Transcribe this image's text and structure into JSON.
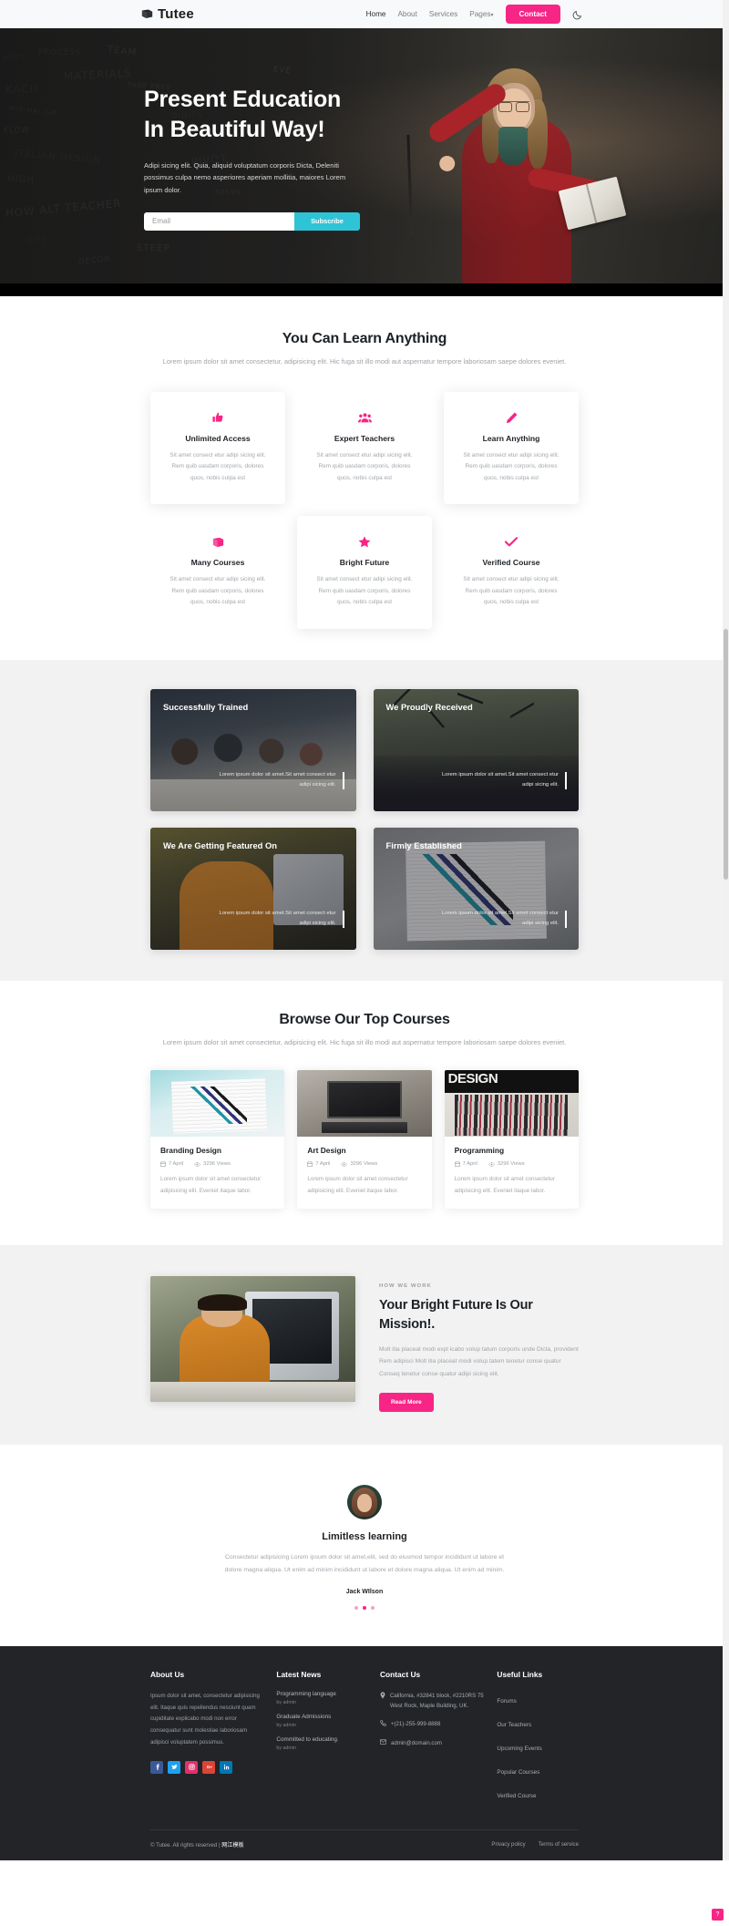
{
  "nav": {
    "brand": "Tutee",
    "brand_icon": "book-icon",
    "links": [
      {
        "label": "Home",
        "active": true
      },
      {
        "label": "About",
        "active": false
      },
      {
        "label": "Services",
        "active": false
      },
      {
        "label": "Pages",
        "active": false,
        "caret": "▾"
      }
    ],
    "contact_label": "Contact",
    "theme_toggle_icon": "moon-icon"
  },
  "hero": {
    "title_line1": "Present Education",
    "title_line2": "In Beautiful Way!",
    "paragraph": "Adipi sicing elit. Quia, aliquid voluptatum corporis Dicta, Deleniti possimus culpa nemo asperiores aperiam mollitia, maiores Lorem ipsum dolor.",
    "email_placeholder": "Email",
    "email_value": "",
    "subscribe_label": "Subscribe",
    "chalk_words": [
      "KITCH",
      "PROCESS",
      "TEAM",
      "KACH",
      "MINIMALISM",
      "FLOW",
      "ITALIAN DESIGN",
      "MATERIALS",
      "PAGE PRES",
      "DIGITS",
      "HIGH",
      "HOW ALT TEACHER",
      "AIMS",
      "DECOR",
      "STEEP",
      "PIVOT",
      "FOCUS",
      "EVE"
    ]
  },
  "learn": {
    "heading": "You Can Learn Anything",
    "subheading": "Lorem ipsum dolor sit amet consectetur, adipisicing elit. Hic fuga sit illo modi aut aspernatur tempore laboriosam saepe dolores eveniet.",
    "cards": [
      {
        "icon": "thumbs-up-icon",
        "title": "Unlimited Access",
        "text": "Sit amet consect etur adipi sicing elit. Rem quib uasdam corporis, dolores quos, nobis culpa est"
      },
      {
        "icon": "users-icon",
        "title": "Expert Teachers",
        "text": "Sit amet consect etur adipi sicing elit. Rem quib uasdam corporis, dolores quos, nobis culpa est"
      },
      {
        "icon": "pencil-icon",
        "title": "Learn Anything",
        "text": "Sit amet consect etur adipi sicing elit. Rem quib uasdam corporis, dolores quos, nobis culpa est"
      },
      {
        "icon": "book-icon",
        "title": "Many Courses",
        "text": "Sit amet consect etur adipi sicing elit. Rem quib uasdam corporis, dolores quos, nobis culpa est"
      },
      {
        "icon": "star-icon",
        "title": "Bright Future",
        "text": "Sit amet consect etur adipi sicing elit. Rem quib uasdam corporis, dolores quos, nobis culpa est"
      },
      {
        "icon": "check-icon",
        "title": "Verified Course",
        "text": "Sit amet consect etur adipi sicing elit. Rem quib uasdam corporis, dolores quos, nobis culpa est"
      }
    ]
  },
  "gallery": {
    "cards": [
      {
        "title": "Successfully Trained",
        "caption": "Lorem ipsum dolor sit amet.Sit amet consect etur adipi sicing elit."
      },
      {
        "title": "We Proudly Received",
        "caption": "Lorem ipsum dolor sit amet.Sit amet consect etur adipi sicing elit."
      },
      {
        "title": "We Are Getting Featured On",
        "caption": "Lorem ipsum dolor sit amet.Sit amet consect etur adipi sicing elit."
      },
      {
        "title": "Firmly Established",
        "caption": "Lorem ipsum dolor sit amet.Sit amet consect etur adipi sicing elit."
      }
    ]
  },
  "courses": {
    "heading": "Browse Our Top Courses",
    "subheading": "Lorem ipsum dolor sit amet consectetur, adipisicing elit. Hic fuga sit illo modi aut aspernatur tempore laboriosam saepe dolores eveniet.",
    "cards": [
      {
        "title": "Branding Design",
        "date": "7 April",
        "views": "3296 Views",
        "text": "Lorem ipsum dolor sit amet consectetur adipisicing elit. Eveniet itaque labor."
      },
      {
        "title": "Art Design",
        "date": "7 April",
        "views": "3296 Views",
        "text": "Lorem ipsum dolor sit amet consectetur adipisicing elit. Eveniet itaque labor."
      },
      {
        "title": "Programming",
        "date": "7 April",
        "views": "3296 Views",
        "text": "Lorem ipsum dolor sit amet consectetur adipisicing elit. Eveniet itaque labor.",
        "thumb_label": "DESIGN"
      }
    ]
  },
  "mission": {
    "kicker": "HOW WE WORK",
    "heading": "Your Bright Future Is Our Mission!.",
    "paragraph": "Molt itia placeat modi expl icabo volup tatum corporis unde Dicta, provident Rem adipisci Molt itia placeat modi volup.tatem tenetur conse quatur Conseq tenetur conse quatur adipi sicing elit.",
    "button": "Read More"
  },
  "testimonial": {
    "avatar": "user-avatar",
    "title": "Limitless learning",
    "quote": "Consectetur adipisicing Lorem ipsum dolor sit amet,elit, sed do eiusmod tempor incididunt ut labore et dolore magna aliqua. Ut enim ad minim incididunt ut labore et dolore magna aliqua. Ut enim ad minim.",
    "author": "Jack WIlson",
    "dots": 3,
    "active_dot": 1
  },
  "footer": {
    "about": {
      "heading": "About Us",
      "text": "Ipsum dolor sit amet, consectetur adipisicing elit. Itaque quis repellendus nesciunt quam cupiditate explicabo modi non error consequatur sunt molestiae laboriosam adipisci voluptatem possimus.",
      "socials": [
        {
          "name": "facebook-icon",
          "color": "#3b5998"
        },
        {
          "name": "twitter-icon",
          "color": "#1da1f2"
        },
        {
          "name": "instagram-icon",
          "color": "#e1306c"
        },
        {
          "name": "google-plus-icon",
          "color": "#db4437"
        },
        {
          "name": "linkedin-icon",
          "color": "#0077b5"
        }
      ]
    },
    "news": {
      "heading": "Latest News",
      "items": [
        {
          "title": "Programming language",
          "by": "by admin"
        },
        {
          "title": "Graduate Admissions",
          "by": "by admin"
        },
        {
          "title": "Committed to educating.",
          "by": "by admin"
        }
      ]
    },
    "contact": {
      "heading": "Contact Us",
      "address": "California, #32841 block, #2210RS 75 West Rock, Maple Building, UK.",
      "phone": "+(21)-255-999-8888",
      "email": "admin@domain.com"
    },
    "links": {
      "heading": "Useful Links",
      "items": [
        "Forums",
        "Our Teachers",
        "Upcoming Events",
        "Popular Courses",
        "Verified Course"
      ]
    },
    "bottom": {
      "copyright": "© Tutee. All rights reserved | ",
      "credit": "网江模板",
      "privacy": "Privacy policy",
      "terms": "Terms of service"
    }
  },
  "colors": {
    "accent": "#f72585",
    "secondary": "#2ec4d6",
    "dark": "#222427"
  },
  "help_badge": "?"
}
